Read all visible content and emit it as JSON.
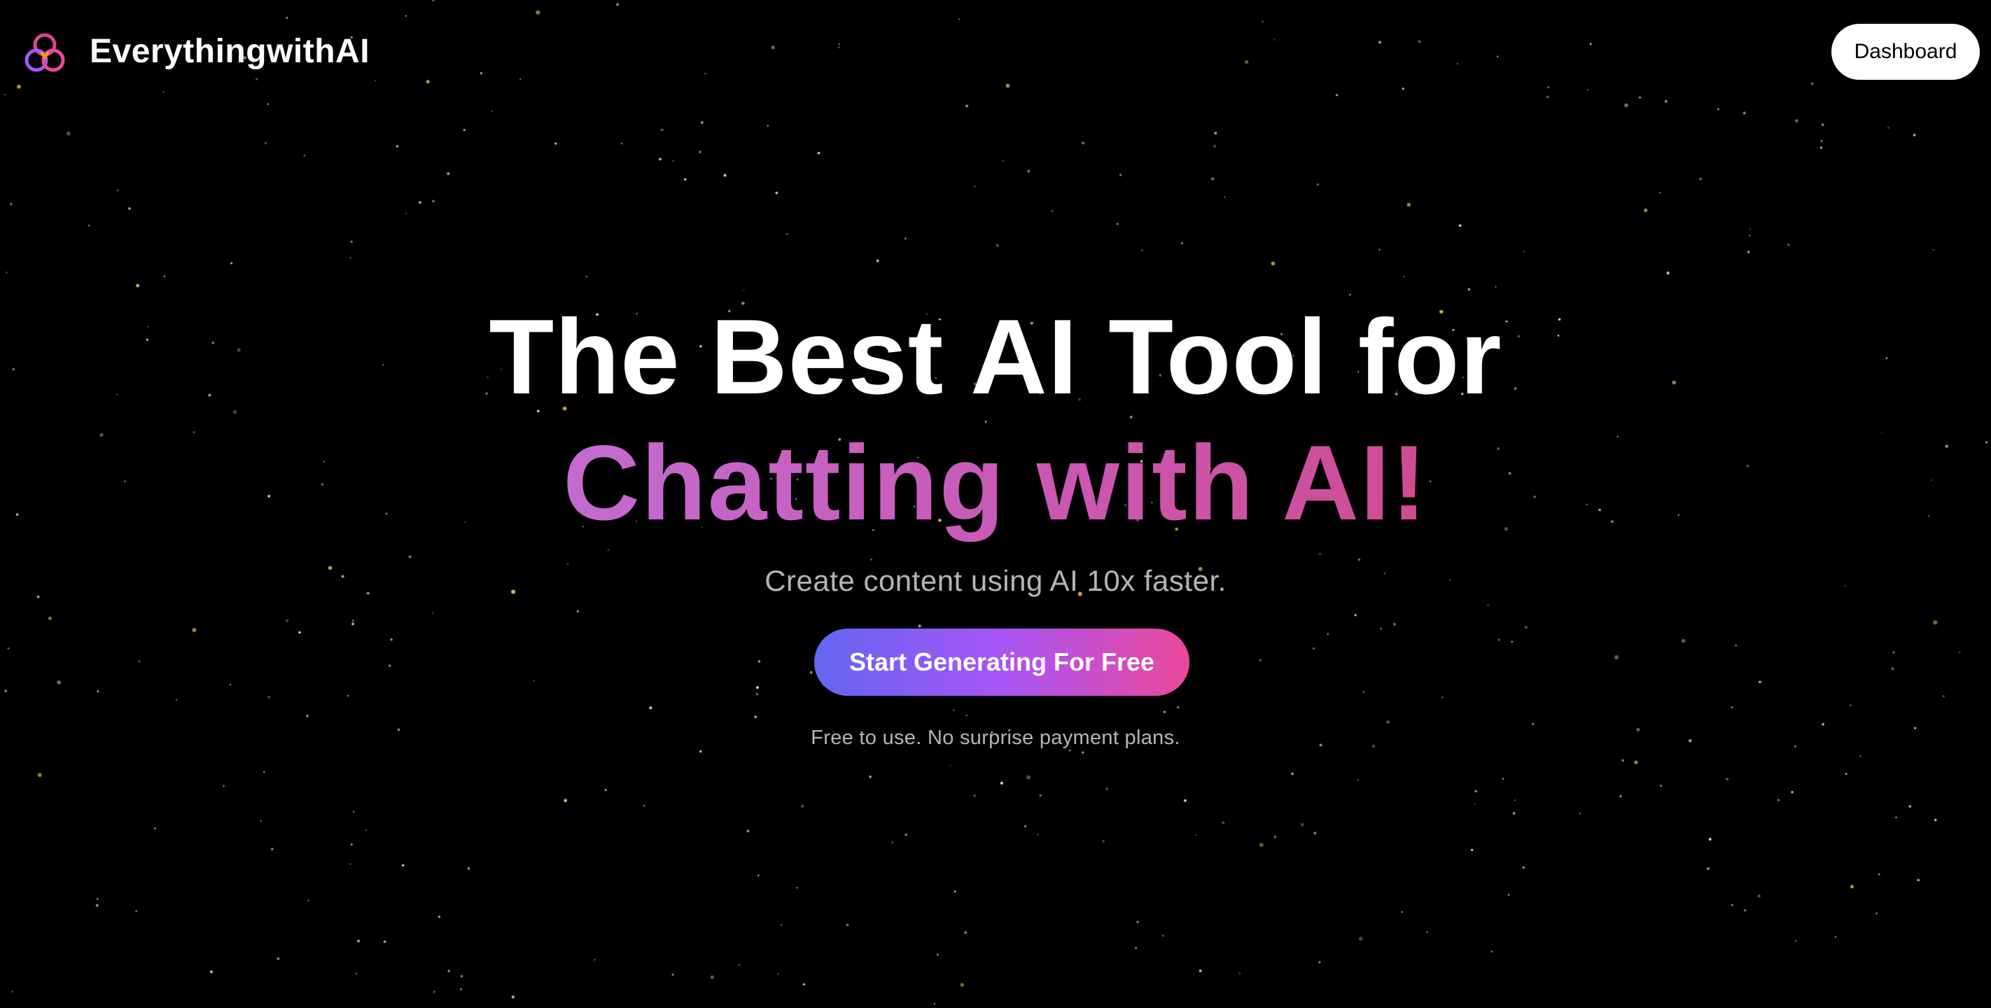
{
  "brand": {
    "name": "EverythingwithAI",
    "logo_icon": "triple-ring-logo-icon"
  },
  "navbar": {
    "dashboard_label": "Dashboard"
  },
  "hero": {
    "headline_line1": "The Best AI Tool for",
    "headline_line2": "Chatting with AI!",
    "subtitle": "Create content using AI 10x faster.",
    "cta_label": "Start Generating For Free",
    "footnote": "Free to use. No surprise payment plans."
  },
  "colors": {
    "background": "#000000",
    "headline": "#ffffff",
    "headline_accent_start": "#c36bd0",
    "headline_accent_end": "#cf4c93",
    "cta_gradient_start": "#6366f1",
    "cta_gradient_mid": "#a855f7",
    "cta_gradient_end": "#ec4899",
    "muted_text": "#b5b5b5",
    "star_white": "#ffffff",
    "star_gold": "#f5c46b"
  }
}
